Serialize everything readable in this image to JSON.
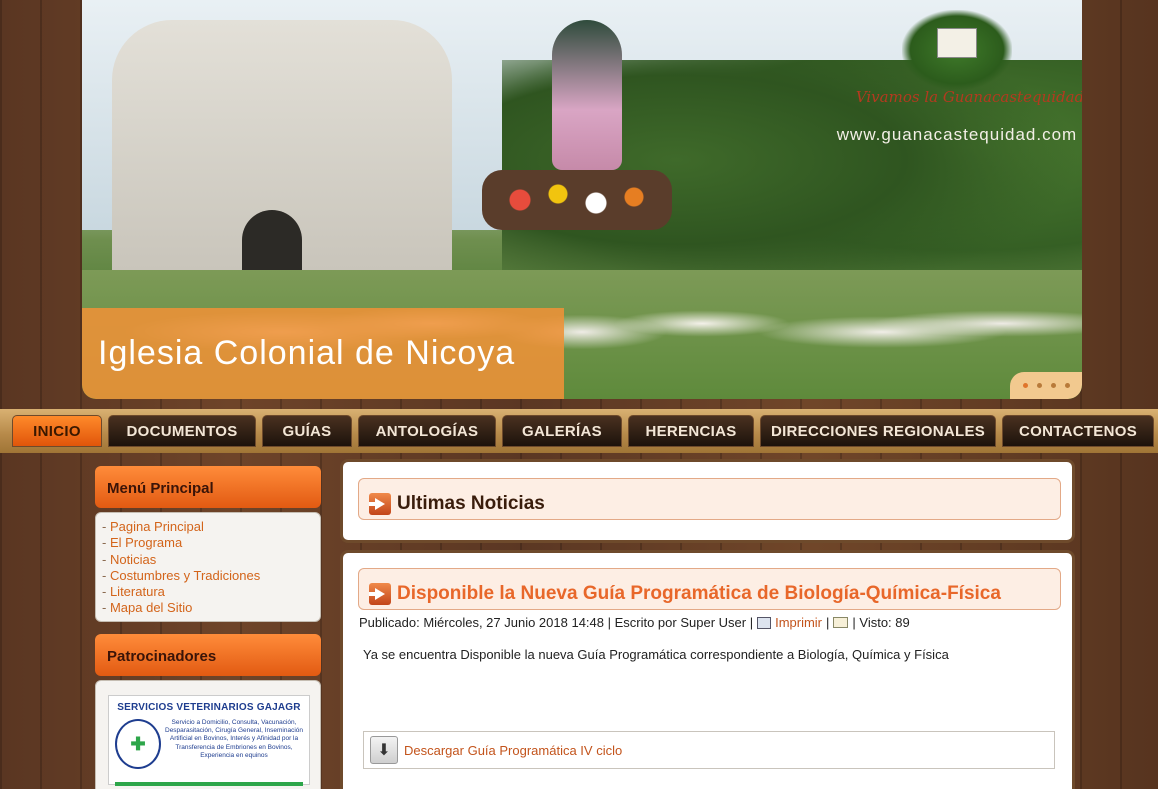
{
  "banner": {
    "caption": "Iglesia Colonial de Nicoya",
    "logo_line1": "Vivamos la Guanacastequidad",
    "logo_line2": "www.guanacastequidad.com",
    "slides_total": 4,
    "slide_active": 1
  },
  "nav": {
    "items": [
      "INICIO",
      "DOCUMENTOS",
      "GUÍAS",
      "ANTOLOGÍAS",
      "GALERÍAS",
      "HERENCIAS",
      "DIRECCIONES REGIONALES",
      "CONTACTENOS"
    ],
    "active_index": 0
  },
  "sidebar": {
    "menu_title": "Menú Principal",
    "menu_items": [
      "Pagina Principal",
      "El Programa",
      "Noticias",
      "Costumbres y Tradiciones",
      "Literatura",
      "Mapa del Sitio"
    ],
    "sponsors_title": "Patrocinadores",
    "sponsor": {
      "name": "SERVICIOS VETERINARIOS GAJAGR",
      "description": "Servicio a Domicilio, Consulta, Vacunación, Desparasitación, Cirugía General, Inseminación Artificial en Bovinos, Interés y Afinidad por la Transferencia de Embriones en Bovinos, Experiencia en equinos"
    }
  },
  "main": {
    "section_title": "Ultimas Noticias",
    "article": {
      "title": "Disponible la Nueva Guía Programática de Biología-Química-Física",
      "published": "Publicado: Miércoles, 27 Junio 2018 14:48 | Escrito por Super User |",
      "print_label": "Imprimir",
      "separator": "|",
      "views": "| Visto: 89",
      "body": "Ya se encuentra Disponible la nueva Guía Programática correspondiente a Biología, Química y Física",
      "download_label": "Descargar Guía Programática IV ciclo"
    }
  },
  "colors": {
    "accent_orange": "#e8672a",
    "nav_active": "#ff8a2a",
    "link": "#c3541c"
  }
}
